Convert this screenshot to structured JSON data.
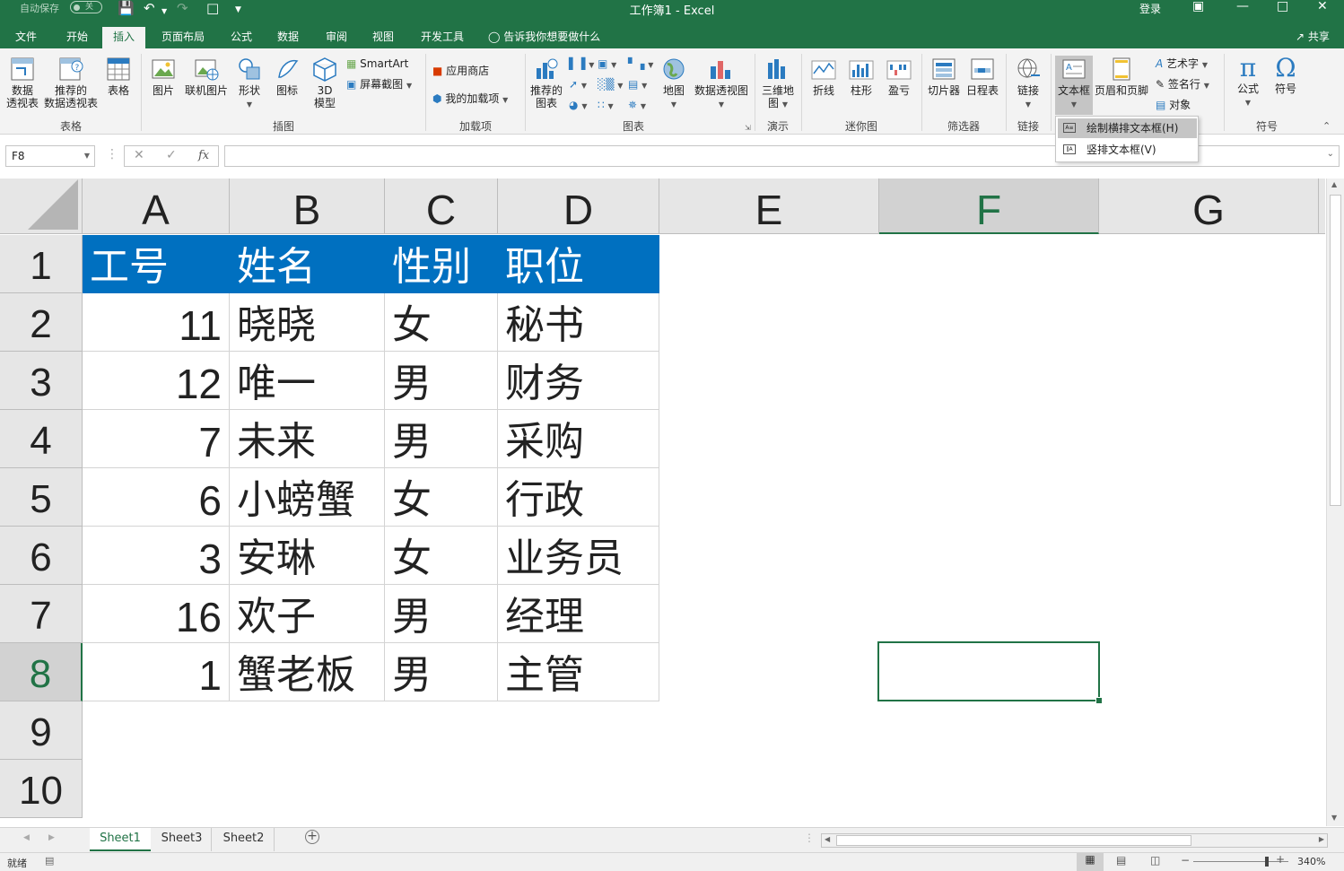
{
  "titlebar": {
    "autosave_label": "自动保存",
    "autosave_state": "关",
    "doc_title": "工作簿1  -  Excel",
    "login": "登录"
  },
  "tabs": [
    "文件",
    "开始",
    "插入",
    "页面布局",
    "公式",
    "数据",
    "审阅",
    "视图",
    "开发工具"
  ],
  "active_tab": "插入",
  "tell_me": "告诉我你想要做什么",
  "share": "共享",
  "ribbon": {
    "groups": {
      "tables": "表格",
      "illustrations": "插图",
      "addins": "加载项",
      "charts": "图表",
      "tours": "演示",
      "sparklines": "迷你图",
      "filters": "筛选器",
      "links": "链接",
      "symbols": "符号"
    },
    "buttons": {
      "pivot_l1": "数据",
      "pivot_l2": "透视表",
      "rec_pivot_l1": "推荐的",
      "rec_pivot_l2": "数据透视表",
      "table": "表格",
      "picture": "图片",
      "online_picture": "联机图片",
      "shapes": "形状",
      "icons": "图标",
      "model3d_l1": "3D",
      "model3d_l2": "模型",
      "smartart": "SmartArt",
      "screenshot": "屏幕截图",
      "store": "应用商店",
      "my_addins": "我的加载项",
      "rec_chart_l1": "推荐的",
      "rec_chart_l2": "图表",
      "map": "地图",
      "pivot_chart": "数据透视图",
      "map3d_l1": "三维地",
      "map3d_l2": "图",
      "line": "折线",
      "column": "柱形",
      "winloss": "盈亏",
      "slicer": "切片器",
      "timeline": "日程表",
      "link": "链接",
      "textbox": "文本框",
      "header_footer": "页眉和页脚",
      "wordart": "艺术字",
      "signature": "签名行",
      "object": "对象",
      "equation": "公式",
      "symbol": "符号"
    }
  },
  "dropdown": {
    "items": [
      "绘制横排文本框(H)",
      "竖排文本框(V)"
    ],
    "highlighted_index": 0
  },
  "formula_bar": {
    "name_box": "F8",
    "fx": "fx",
    "formula": ""
  },
  "grid": {
    "columns": [
      "A",
      "B",
      "C",
      "D",
      "E",
      "F",
      "G"
    ],
    "rows": [
      "1",
      "2",
      "3",
      "4",
      "5",
      "6",
      "7",
      "8",
      "9",
      "10"
    ],
    "selected_cell": "F8",
    "header_fill": "#0070c0",
    "header_row": [
      "工号",
      "姓名",
      "性别",
      "职位"
    ],
    "data": [
      [
        "11",
        "晓晓",
        "女",
        "秘书"
      ],
      [
        "12",
        "唯一",
        "男",
        "财务"
      ],
      [
        "7",
        "未来",
        "男",
        "采购"
      ],
      [
        "6",
        "小螃蟹",
        "女",
        "行政"
      ],
      [
        "3",
        "安琳",
        "女",
        "业务员"
      ],
      [
        "16",
        "欢子",
        "男",
        "经理"
      ],
      [
        "1",
        "蟹老板",
        "男",
        "主管"
      ]
    ]
  },
  "sheets": [
    "Sheet1",
    "Sheet3",
    "Sheet2"
  ],
  "active_sheet": "Sheet1",
  "status": {
    "ready": "就绪",
    "zoom": "340%"
  },
  "colors": {
    "excel_green": "#217346",
    "header_blue": "#0070c0"
  }
}
